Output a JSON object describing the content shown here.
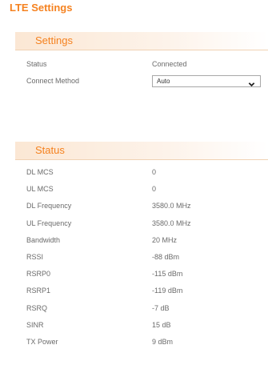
{
  "page_title": "LTE Settings",
  "settings": {
    "header": "Settings",
    "status_label": "Status",
    "status_value": "Connected",
    "connect_method_label": "Connect Method",
    "connect_method_value": "Auto"
  },
  "status": {
    "header": "Status",
    "rows": [
      {
        "label": "DL MCS",
        "value": "0"
      },
      {
        "label": "UL MCS",
        "value": "0"
      },
      {
        "label": "DL Frequency",
        "value": "3580.0 MHz"
      },
      {
        "label": "UL Frequency",
        "value": "3580.0 MHz"
      },
      {
        "label": "Bandwidth",
        "value": "20 MHz"
      },
      {
        "label": "RSSI",
        "value": "-88 dBm"
      },
      {
        "label": "RSRP0",
        "value": "-115 dBm"
      },
      {
        "label": "RSRP1",
        "value": "-119 dBm"
      },
      {
        "label": "RSRQ",
        "value": "-7 dB"
      },
      {
        "label": "SINR",
        "value": "15 dB"
      },
      {
        "label": "TX Power",
        "value": "9 dBm"
      }
    ]
  },
  "colors": {
    "accent": "#f58220",
    "text": "#6b6b6b"
  },
  "icons": {
    "dropdown": "chevron-down-icon"
  }
}
